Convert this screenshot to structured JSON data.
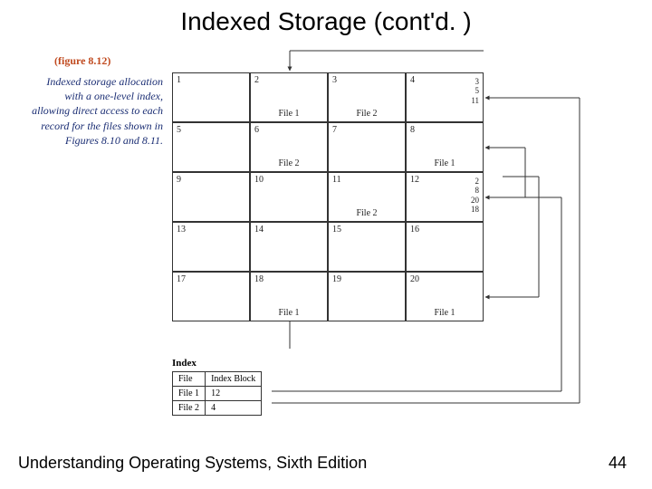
{
  "title": "Indexed Storage (cont'd. )",
  "figure_label": "(figure 8.12)",
  "caption": "Indexed storage allocation with a one-level index, allowing direct access to each record for the files shown in Figures 8.10 and 8.11.",
  "footer_left": "Understanding Operating Systems, Sixth Edition",
  "footer_right": "44",
  "grid": [
    [
      {
        "n": "1"
      },
      {
        "n": "2",
        "f": "File 1"
      },
      {
        "n": "3",
        "f": "File 2"
      },
      {
        "n": "4",
        "idx": [
          "3",
          "5",
          "11"
        ]
      }
    ],
    [
      {
        "n": "5"
      },
      {
        "n": "6",
        "f": "File 2"
      },
      {
        "n": "7"
      },
      {
        "n": "8",
        "f": "File 1"
      }
    ],
    [
      {
        "n": "9"
      },
      {
        "n": "10"
      },
      {
        "n": "11",
        "f": "File 2"
      },
      {
        "n": "12",
        "idx": [
          "2",
          "8",
          "20",
          "18"
        ]
      }
    ],
    [
      {
        "n": "13"
      },
      {
        "n": "14"
      },
      {
        "n": "15"
      },
      {
        "n": "16"
      }
    ],
    [
      {
        "n": "17"
      },
      {
        "n": "18",
        "f": "File 1"
      },
      {
        "n": "19"
      },
      {
        "n": "20",
        "f": "File 1"
      }
    ]
  ],
  "index_table": {
    "title": "Index",
    "headers": [
      "File",
      "Index Block"
    ],
    "rows": [
      [
        "File 1",
        "12"
      ],
      [
        "File 2",
        "4"
      ]
    ]
  }
}
